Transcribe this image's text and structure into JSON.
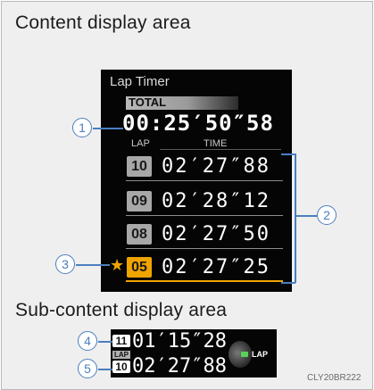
{
  "top_heading": "Content display area",
  "bottom_heading": "Sub-content display area",
  "image_code": "CLY20BR222",
  "lap_timer": {
    "title": "Lap Timer",
    "total_label": "TOTAL",
    "total_time": "00:25′50″58",
    "col_lap": "LAP",
    "col_time": "TIME",
    "laps": [
      {
        "lap": "10",
        "time": "02′27″88",
        "best": false
      },
      {
        "lap": "09",
        "time": "02′28″12",
        "best": false
      },
      {
        "lap": "08",
        "time": "02′27″50",
        "best": false
      },
      {
        "lap": "05",
        "time": "02′27″25",
        "best": true
      }
    ],
    "star": "★"
  },
  "sub": {
    "row1_lap": "11",
    "row1_time": "01′15″28",
    "lap_tag": "LAP",
    "row2_lap": "10",
    "row2_time": "02′27″88",
    "switch_label": "LAP"
  },
  "callouts": [
    "1",
    "2",
    "3",
    "4",
    "5"
  ],
  "colors": {
    "accent_blue": "#4a7fbf",
    "best_lap_orange": "#f0a400",
    "badge_grey": "#a8a8a8",
    "screen_black": "#050505"
  }
}
